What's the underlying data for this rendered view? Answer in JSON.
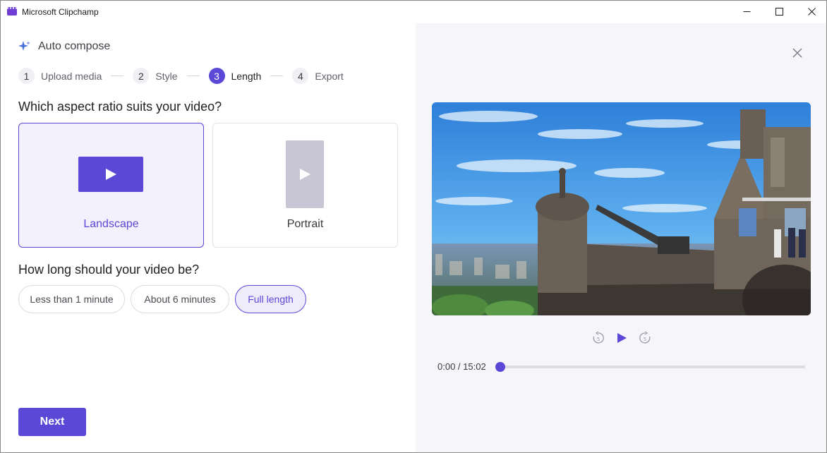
{
  "window": {
    "title": "Microsoft Clipchamp"
  },
  "header": {
    "title": "Auto compose"
  },
  "steps": [
    {
      "number": "1",
      "label": "Upload media"
    },
    {
      "number": "2",
      "label": "Style"
    },
    {
      "number": "3",
      "label": "Length"
    },
    {
      "number": "4",
      "label": "Export"
    }
  ],
  "aspect": {
    "question": "Which aspect ratio suits your video?",
    "options": [
      {
        "label": "Landscape",
        "selected": true
      },
      {
        "label": "Portrait",
        "selected": false
      }
    ]
  },
  "length": {
    "question": "How long should your video be?",
    "options": [
      {
        "label": "Less than 1 minute",
        "selected": false
      },
      {
        "label": "About 6 minutes",
        "selected": false
      },
      {
        "label": "Full length",
        "selected": true
      }
    ]
  },
  "next_label": "Next",
  "player": {
    "time": "0:00 / 15:02",
    "progress": 0
  },
  "colors": {
    "accent": "#5b48d6",
    "accent_light": "#f3f1fd",
    "pane_bg": "#f5f5fa"
  },
  "icons": {
    "app": "clipchamp-logo-icon",
    "sparkle": "sparkle-icon",
    "minimize": "minimize-icon",
    "maximize": "maximize-icon",
    "close": "close-icon",
    "play": "play-icon",
    "rewind": "rewind-5-icon",
    "forward": "forward-5-icon"
  }
}
